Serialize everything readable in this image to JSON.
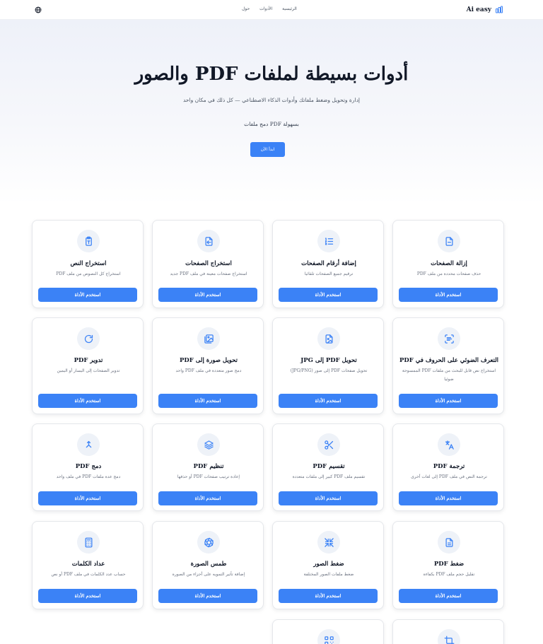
{
  "nav": {
    "brand": "Ai easy",
    "links": [
      "الرئيسية",
      "الأدوات",
      "حول"
    ]
  },
  "hero": {
    "title": "أدوات بسيطة لملفات PDF والصور",
    "subtitle": "إدارة وتحويل وضغط ملفاتك وأدوات الذكاء الاصطناعي — كل ذلك في مكان واحد",
    "tagline": "بسهولة PDF دمج ملفات",
    "cta": "ابدأ الآن"
  },
  "tool_button_label": "استخدم الأداة",
  "colors": {
    "accent": "#3b82f6",
    "icon": "#3b82f6",
    "icon_bg": "#eef2f8"
  },
  "tools": [
    {
      "title": "إزالة الصفحات",
      "desc": "حذف صفحات محددة من ملف PDF",
      "icon": "file-minus-icon"
    },
    {
      "title": "إضافة أرقام الصفحات",
      "desc": "ترقيم جميع الصفحات تلقائيا",
      "icon": "list-ordered-icon"
    },
    {
      "title": "استخراج الصفحات",
      "desc": "استخراج صفحات معينة في ملف PDF جديد",
      "icon": "file-export-icon"
    },
    {
      "title": "استخراج النص",
      "desc": "استخراج كل النصوص من ملف PDF",
      "icon": "clipboard-text-icon"
    },
    {
      "title": "التعرف الضوئي على الحروف في PDF",
      "desc": "استخراج نص قابل للبحث من ملفات PDF الممسوحة ضوئيا",
      "icon": "scan-text-icon"
    },
    {
      "title": "تحويل PDF إلى JPG",
      "desc": "تحويل صفحات PDF إلى صور (JPG/PNG)",
      "icon": "file-image-icon"
    },
    {
      "title": "تحويل صورة إلى PDF",
      "desc": "دمج صور متعددة في ملف PDF واحد",
      "icon": "images-icon"
    },
    {
      "title": "تدوير PDF",
      "desc": "تدوير الصفحات إلى اليسار أو اليمين",
      "icon": "rotate-icon"
    },
    {
      "title": "ترجمة PDF",
      "desc": "ترجمة النص في ملف PDF إلى لغات أخرى",
      "icon": "translate-icon"
    },
    {
      "title": "تقسيم PDF",
      "desc": "تقسيم ملف PDF كبير إلى ملفات متعددة",
      "icon": "scissors-icon"
    },
    {
      "title": "تنظيم PDF",
      "desc": "إعادة ترتيب صفحات PDF أو حذفها",
      "icon": "layers-icon"
    },
    {
      "title": "دمج PDF",
      "desc": "دمج عدة ملفات PDF في ملف واحد",
      "icon": "merge-icon"
    },
    {
      "title": "ضغط PDF",
      "desc": "تقليل حجم ملف PDF بكفاءة",
      "icon": "file-text-icon"
    },
    {
      "title": "ضغط الصور",
      "desc": "ضغط ملفات الصور المختلفة",
      "icon": "minimize-icon"
    },
    {
      "title": "طمس الصورة",
      "desc": "إضافة تأثير التمويه على أجزاء من الصورة",
      "icon": "aperture-icon"
    },
    {
      "title": "عداد الكلمات",
      "desc": "حساب عدد الكلمات في ملف PDF أو نص",
      "icon": "calculator-icon"
    },
    {
      "title": "",
      "desc": "",
      "icon": "crop-icon"
    },
    {
      "title": "",
      "desc": "",
      "icon": "qr-code-icon"
    }
  ]
}
